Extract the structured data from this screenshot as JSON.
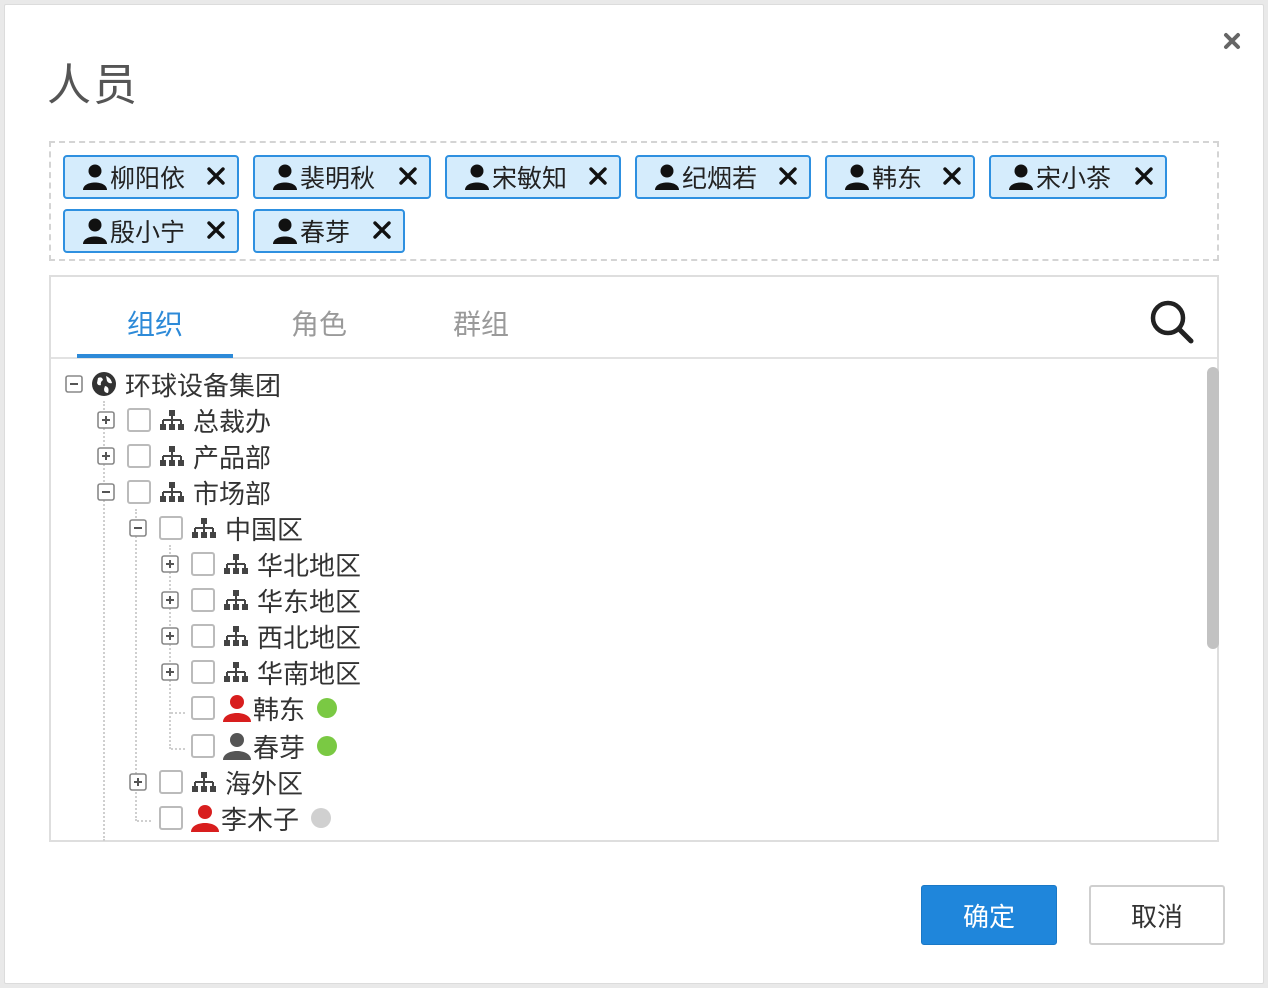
{
  "dialog": {
    "title": "人员",
    "close_icon": "close-icon",
    "selected_users": [
      {
        "name": "柳阳依"
      },
      {
        "name": "裴明秋"
      },
      {
        "name": "宋敏知"
      },
      {
        "name": "纪烟若"
      },
      {
        "name": "韩东"
      },
      {
        "name": "宋小茶"
      },
      {
        "name": "殷小宁"
      },
      {
        "name": "春芽"
      }
    ],
    "tabs": [
      {
        "label": "组织",
        "active": true
      },
      {
        "label": "角色",
        "active": false
      },
      {
        "label": "群组",
        "active": false
      }
    ],
    "search_icon": "search-icon",
    "tree": {
      "root": "环球设备集团",
      "nodes": [
        {
          "label": "总裁办",
          "type": "org",
          "expanded": false
        },
        {
          "label": "产品部",
          "type": "org",
          "expanded": false
        },
        {
          "label": "市场部",
          "type": "org",
          "expanded": true
        },
        {
          "label": "中国区",
          "type": "org",
          "expanded": true
        },
        {
          "label": "华北地区",
          "type": "org",
          "expanded": false
        },
        {
          "label": "华东地区",
          "type": "org",
          "expanded": false
        },
        {
          "label": "西北地区",
          "type": "org",
          "expanded": false
        },
        {
          "label": "华南地区",
          "type": "org",
          "expanded": false
        },
        {
          "label": "韩东",
          "type": "user",
          "user_color": "#d81e1e",
          "status": "online"
        },
        {
          "label": "春芽",
          "type": "user",
          "user_color": "#555555",
          "status": "online"
        },
        {
          "label": "海外区",
          "type": "org",
          "expanded": false
        },
        {
          "label": "李木子",
          "type": "user",
          "user_color": "#d81e1e",
          "status": "offline"
        }
      ]
    },
    "buttons": {
      "ok": "确定",
      "cancel": "取消"
    },
    "colors": {
      "accent": "#1f86db",
      "chip_bg": "#d5ecfc",
      "online": "#7ac943",
      "offline": "#d0d0d0"
    }
  }
}
